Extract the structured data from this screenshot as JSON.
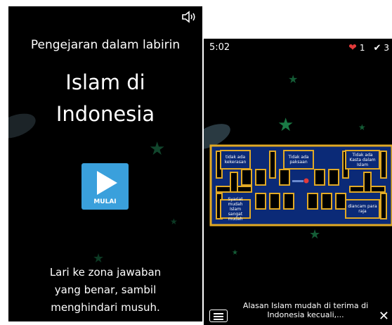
{
  "start_screen": {
    "subtitle": "Pengejaran dalam labirin",
    "title_line1": "Islam di",
    "title_line2": "Indonesia",
    "play_label": "MULAI",
    "instructions_line1": "Lari ke zona jawaban",
    "instructions_line2": "yang benar, sambil",
    "instructions_line3": "menghindari musuh.",
    "speaker_icon": "speaker-icon"
  },
  "game_screen": {
    "timer": "5:02",
    "lives": "1",
    "correct": "3",
    "answers": [
      "tidak ada kekerasan",
      "Tidak ada paksaan",
      "Tidak ada Kasta dalam Islam",
      "Syariat mudah Islam sangat mudah",
      "diancam para raja"
    ],
    "question": "Alasan Islam mudah di terima di Indonesia kecuali,...",
    "colors": {
      "maze_wall": "#e1a925",
      "maze_fill": "#0b2a77",
      "play_button": "#3aa0dc",
      "heart": "#e23a3a"
    }
  }
}
